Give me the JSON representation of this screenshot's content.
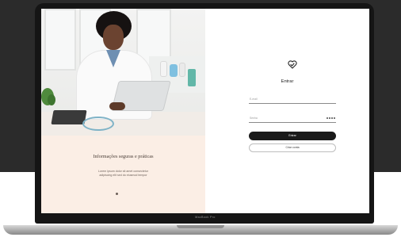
{
  "device": {
    "bezel_label": "MacBook Pro"
  },
  "hero": {
    "title": "Informações seguras e práticas",
    "description": "Lorem ipsum dolor sit amet consectetur adipiscing elit sed do eiusmod tempor"
  },
  "login": {
    "title": "Entrar",
    "email_placeholder": "E-mail",
    "password_placeholder": "Senha",
    "primary_button_label": "Entrar",
    "secondary_button_label": "Criar conta"
  },
  "colors": {
    "hero_background": "#fbeee5",
    "primary_button": "#1a1a1a",
    "screen_background": "#ffffff"
  },
  "icons": {
    "logo": "heart-check-icon",
    "password_toggle": "eye-icon"
  }
}
